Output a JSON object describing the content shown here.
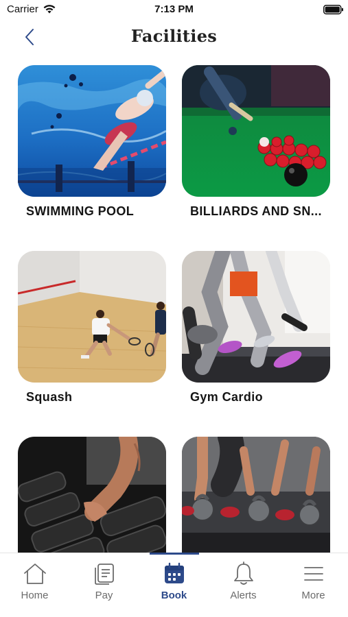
{
  "status_bar": {
    "carrier": "Carrier",
    "time": "7:13 PM"
  },
  "header": {
    "title": "Facilities",
    "back_icon": "chevron-left-icon"
  },
  "facilities": [
    {
      "label": "SWIMMING POOL",
      "image": "swimming-pool-photo"
    },
    {
      "label": "BILLIARDS AND SN...",
      "image": "billiards-snooker-photo"
    },
    {
      "label": "Squash",
      "image": "squash-court-photo"
    },
    {
      "label": "Gym Cardio",
      "image": "gym-treadmill-photo"
    },
    {
      "label": "",
      "image": "dumbbell-rack-photo"
    },
    {
      "label": "",
      "image": "kettlebell-class-photo"
    }
  ],
  "tab_bar": {
    "active": "Book",
    "tabs": [
      {
        "label": "Home",
        "icon": "home-icon"
      },
      {
        "label": "Pay",
        "icon": "receipt-icon"
      },
      {
        "label": "Book",
        "icon": "calendar-icon"
      },
      {
        "label": "Alerts",
        "icon": "bell-icon"
      },
      {
        "label": "More",
        "icon": "menu-icon"
      }
    ]
  },
  "colors": {
    "accent": "#2d4a8a",
    "tab_inactive": "#6b6b6b",
    "title_text": "#222222"
  }
}
